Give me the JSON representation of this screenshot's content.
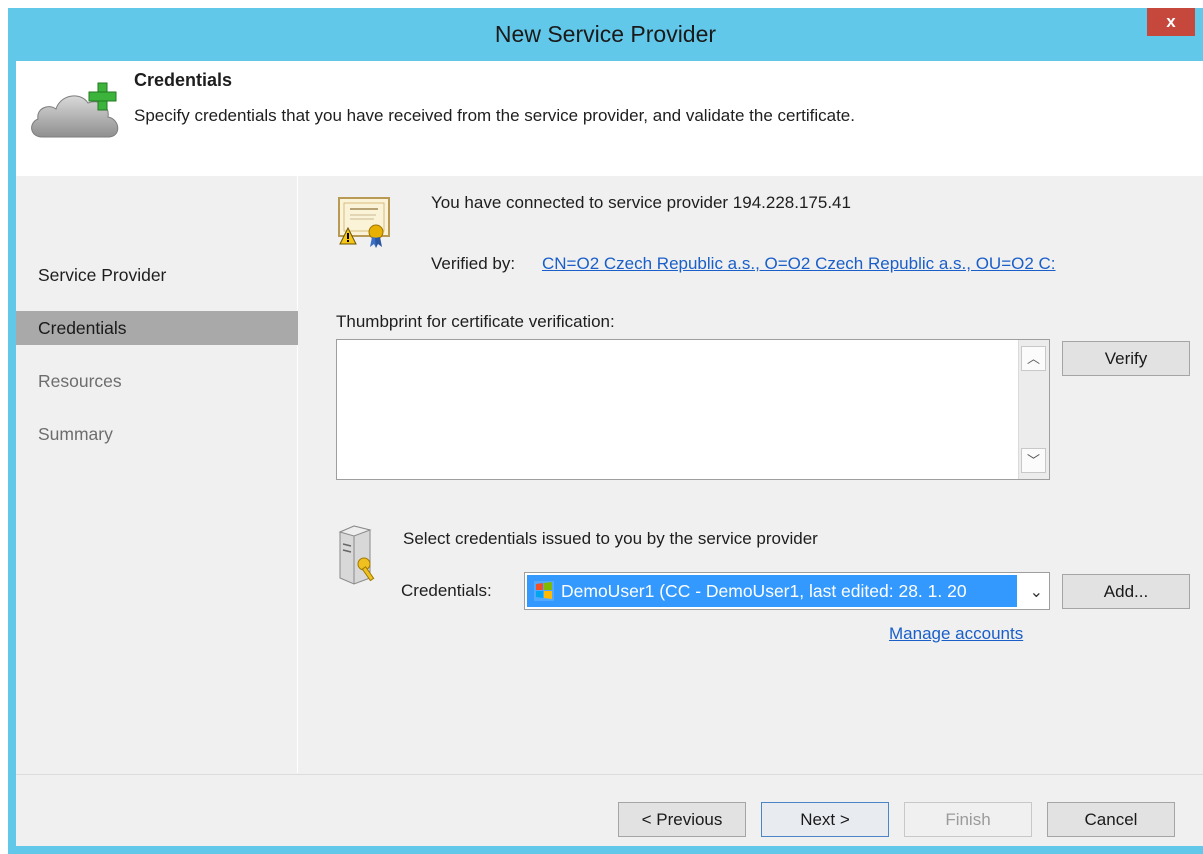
{
  "window": {
    "title": "New Service Provider",
    "close_label": "x"
  },
  "header": {
    "title": "Credentials",
    "description": "Specify credentials that you have received from the service provider, and validate the certificate."
  },
  "sidebar": {
    "items": [
      {
        "label": "Service Provider",
        "state": "normal"
      },
      {
        "label": "Credentials",
        "state": "active"
      },
      {
        "label": "Resources",
        "state": "disabled"
      },
      {
        "label": "Summary",
        "state": "disabled"
      }
    ]
  },
  "main": {
    "connected_text": "You have connected to service provider 194.228.175.41",
    "verified_label": "Verified by:",
    "verified_link": "CN=O2 Czech Republic a.s., O=O2 Czech Republic a.s., OU=O2 C:",
    "thumbprint_label": "Thumbprint for certificate verification:",
    "thumbprint_value": "",
    "verify_button": "Verify",
    "select_credentials_text": "Select credentials issued to you by the service provider",
    "credentials_label": "Credentials:",
    "credentials_value": "DemoUser1 (CC - DemoUser1, last edited: 28. 1. 20",
    "add_button": "Add...",
    "manage_link": "Manage accounts"
  },
  "footer": {
    "previous": "< Previous",
    "next": "Next >",
    "finish": "Finish",
    "cancel": "Cancel"
  },
  "colors": {
    "titlebar": "#62c8ea",
    "close": "#c6473c",
    "selection": "#3399ff",
    "link": "#1a5fc9",
    "active_nav": "#a9a9a9"
  }
}
